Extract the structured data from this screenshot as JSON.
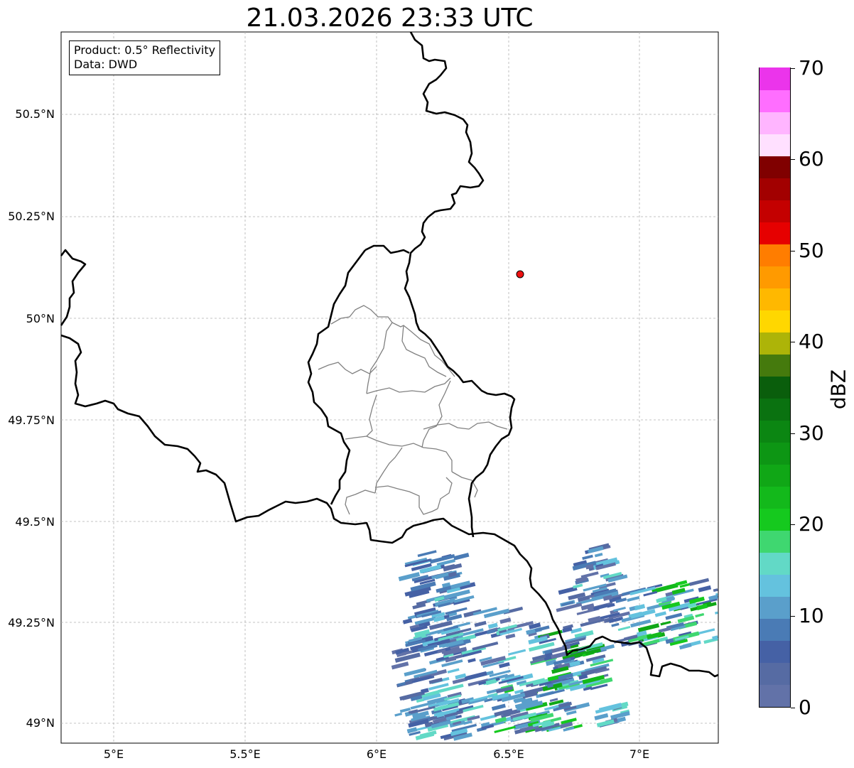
{
  "title": "21.03.2026 23:33 UTC",
  "info": {
    "product": "Product: 0.5° Reflectivity",
    "data": "Data: DWD"
  },
  "axes": {
    "lon_ticks": [
      "5°E",
      "5.5°E",
      "6°E",
      "6.5°E",
      "7°E"
    ],
    "lat_ticks": [
      "50.5°N",
      "50.25°N",
      "50°N",
      "49.75°N",
      "49.5°N",
      "49.25°N",
      "49°N"
    ],
    "lon_range": [
      4.8,
      7.3
    ],
    "lat_range": [
      48.95,
      50.7
    ]
  },
  "colorbar": {
    "label": "dBZ",
    "ticks": [
      "0",
      "10",
      "20",
      "30",
      "40",
      "50",
      "60",
      "70"
    ],
    "colors": [
      "#6272a8",
      "#566ba3",
      "#4561a5",
      "#4a7bb5",
      "#5a9fcb",
      "#64c2de",
      "#62d9c6",
      "#3fd770",
      "#15c91e",
      "#13b91b",
      "#10a716",
      "#0d9614",
      "#0b8612",
      "#0a7210",
      "#0a5e0c",
      "#457a0d",
      "#adb408",
      "#ffd700",
      "#ffb800",
      "#ff9a00",
      "#ff7d00",
      "#e60000",
      "#c40000",
      "#a20000",
      "#800000",
      "#ffe0ff",
      "#ffb5ff",
      "#ff6eff",
      "#eb34eb"
    ]
  },
  "station_marker": {
    "lon": 6.55,
    "lat": 50.11,
    "color": "#ee1111"
  }
}
